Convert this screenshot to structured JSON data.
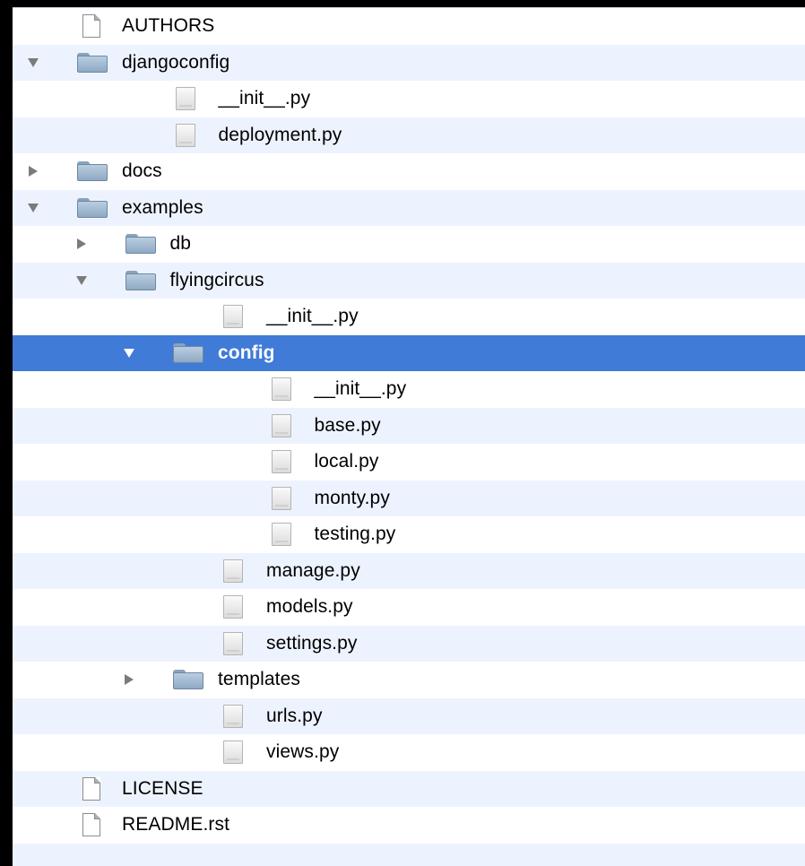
{
  "tree": {
    "items": [
      {
        "label": "AUTHORS",
        "kind": "doc",
        "depth": 0,
        "disclosure": "none",
        "icon": "document-icon"
      },
      {
        "label": "djangoconfig",
        "kind": "folder",
        "depth": 0,
        "disclosure": "open",
        "icon": "folder-icon"
      },
      {
        "label": "__init__.py",
        "kind": "py",
        "depth": 1,
        "disclosure": "none",
        "icon": "python-file-icon"
      },
      {
        "label": "deployment.py",
        "kind": "py",
        "depth": 1,
        "disclosure": "none",
        "icon": "python-file-icon"
      },
      {
        "label": "docs",
        "kind": "folder",
        "depth": 0,
        "disclosure": "closed",
        "icon": "folder-icon"
      },
      {
        "label": "examples",
        "kind": "folder",
        "depth": 0,
        "disclosure": "open",
        "icon": "folder-icon"
      },
      {
        "label": "db",
        "kind": "folder",
        "depth": 1,
        "disclosure": "closed",
        "icon": "folder-icon"
      },
      {
        "label": "flyingcircus",
        "kind": "folder",
        "depth": 1,
        "disclosure": "open",
        "icon": "folder-icon"
      },
      {
        "label": "__init__.py",
        "kind": "py",
        "depth": 2,
        "disclosure": "none",
        "icon": "python-file-icon"
      },
      {
        "label": "config",
        "kind": "folder",
        "depth": 2,
        "disclosure": "open",
        "icon": "folder-icon",
        "selected": true
      },
      {
        "label": "__init__.py",
        "kind": "py",
        "depth": 3,
        "disclosure": "none",
        "icon": "python-file-icon"
      },
      {
        "label": "base.py",
        "kind": "py",
        "depth": 3,
        "disclosure": "none",
        "icon": "python-file-icon"
      },
      {
        "label": "local.py",
        "kind": "py",
        "depth": 3,
        "disclosure": "none",
        "icon": "python-file-icon"
      },
      {
        "label": "monty.py",
        "kind": "py",
        "depth": 3,
        "disclosure": "none",
        "icon": "python-file-icon"
      },
      {
        "label": "testing.py",
        "kind": "py",
        "depth": 3,
        "disclosure": "none",
        "icon": "python-file-icon"
      },
      {
        "label": "manage.py",
        "kind": "py",
        "depth": 2,
        "disclosure": "none",
        "icon": "python-file-icon"
      },
      {
        "label": "models.py",
        "kind": "py",
        "depth": 2,
        "disclosure": "none",
        "icon": "python-file-icon"
      },
      {
        "label": "settings.py",
        "kind": "py",
        "depth": 2,
        "disclosure": "none",
        "icon": "python-file-icon"
      },
      {
        "label": "templates",
        "kind": "folder",
        "depth": 2,
        "disclosure": "closed",
        "icon": "folder-icon"
      },
      {
        "label": "urls.py",
        "kind": "py",
        "depth": 2,
        "disclosure": "none",
        "icon": "python-file-icon"
      },
      {
        "label": "views.py",
        "kind": "py",
        "depth": 2,
        "disclosure": "none",
        "icon": "python-file-icon"
      },
      {
        "label": "LICENSE",
        "kind": "doc",
        "depth": 0,
        "disclosure": "none",
        "icon": "document-icon"
      },
      {
        "label": "README.rst",
        "kind": "doc",
        "depth": 0,
        "disclosure": "none",
        "icon": "document-icon"
      }
    ]
  },
  "colors": {
    "selection": "#3f7bd7",
    "alternate_row": "#edf3fe",
    "row": "#ffffff",
    "window_background": "#000000"
  }
}
